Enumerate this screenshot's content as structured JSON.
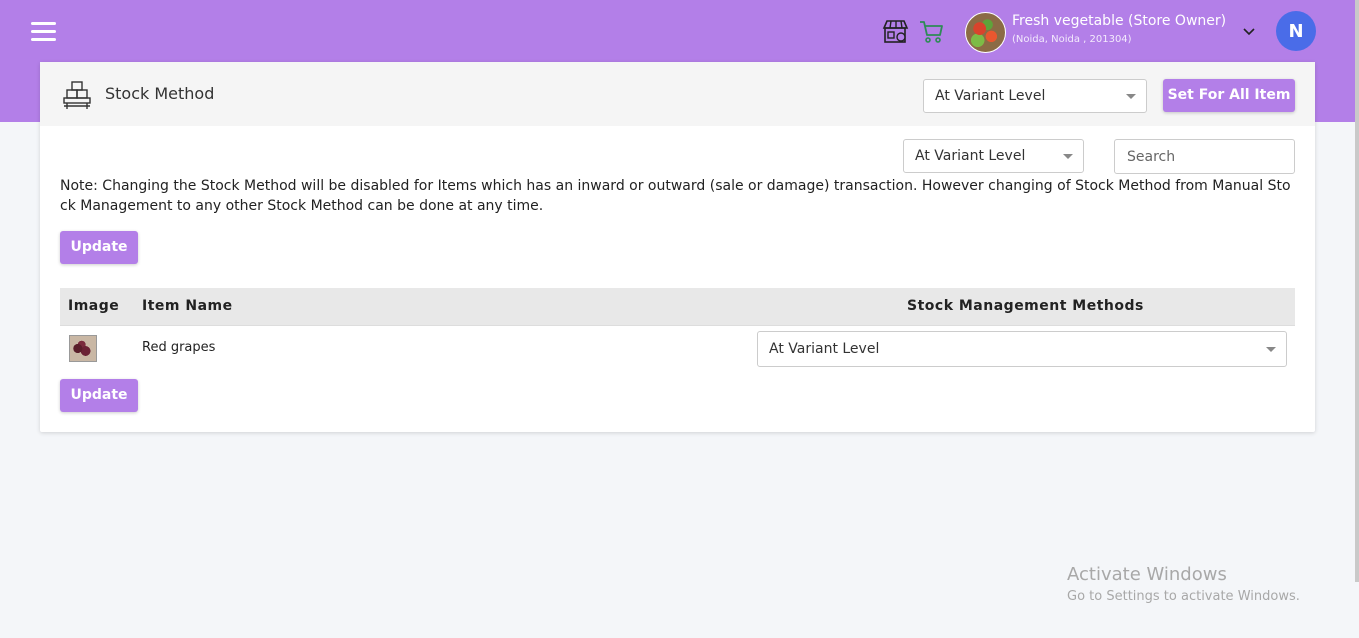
{
  "header": {
    "store_name": "Fresh vegetable (Store Owner)",
    "store_address": "(Noida, Noida , 201304)",
    "user_initial": "N",
    "accent_color": "#b37fe8",
    "icons": [
      "menu-icon",
      "store-icon",
      "cart-icon",
      "chevron-down-icon"
    ]
  },
  "card": {
    "title": "Stock Method",
    "header_select_value": "At Variant Level",
    "set_all_button": "Set For All Item",
    "filter_select_value": "At Variant Level",
    "search_placeholder": "Search",
    "note": "Note: Changing the Stock Method will be disabled for Items which has an inward or outward (sale or damage) transaction. However changing of Stock Method from Manual Stock Management to any other Stock Method can be done at any time.",
    "update_label_top": "Update",
    "update_label_bottom": "Update"
  },
  "table": {
    "columns": [
      "Image",
      "Item Name",
      "Stock Management Methods"
    ],
    "rows": [
      {
        "item_name": "Red grapes",
        "method": "At Variant Level"
      }
    ]
  },
  "watermark": {
    "line1": "Activate Windows",
    "line2": "Go to Settings to activate Windows."
  }
}
